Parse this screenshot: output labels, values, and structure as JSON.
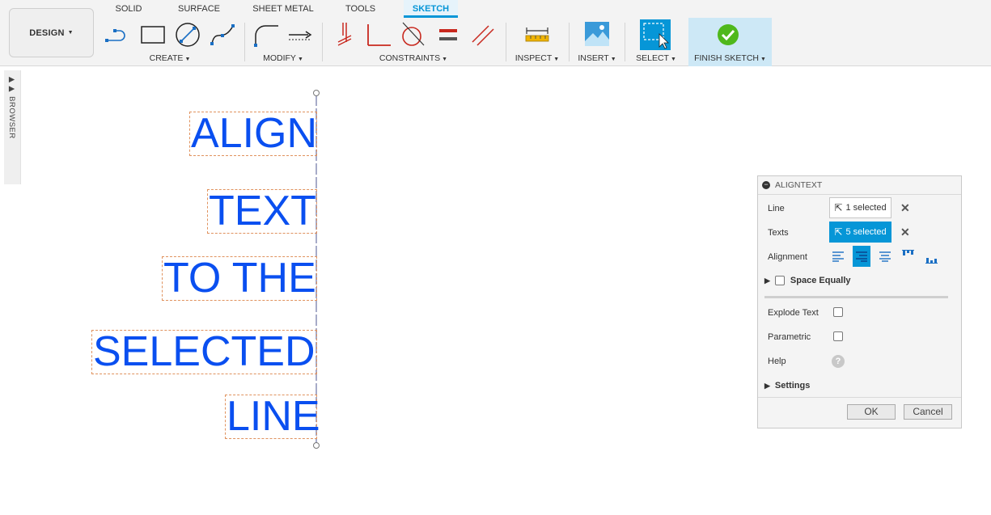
{
  "toolbar": {
    "design_label": "DESIGN",
    "tabs": [
      "SOLID",
      "SURFACE",
      "SHEET METAL",
      "TOOLS",
      "SKETCH"
    ],
    "active_tab": "SKETCH",
    "groups": {
      "create": "CREATE",
      "modify": "MODIFY",
      "constraints": "CONSTRAINTS",
      "inspect": "INSPECT",
      "insert": "INSERT",
      "select": "SELECT",
      "finish": "FINISH SKETCH"
    },
    "accent_color": "#0696d7"
  },
  "browser": {
    "label": "BROWSER"
  },
  "canvas": {
    "texts": [
      "ALIGN",
      "TEXT",
      "TO THE",
      "SELECTED",
      "LINE"
    ],
    "text_color": "#0a4ff0",
    "box_color": "#e0925e"
  },
  "dialog": {
    "title": "ALIGNTEXT",
    "line_label": "Line",
    "line_value": "1 selected",
    "texts_label": "Texts",
    "texts_value": "5 selected",
    "alignment_label": "Alignment",
    "space_equally_label": "Space Equally",
    "explode_text_label": "Explode Text",
    "parametric_label": "Parametric",
    "help_label": "Help",
    "settings_label": "Settings",
    "ok_label": "OK",
    "cancel_label": "Cancel"
  }
}
